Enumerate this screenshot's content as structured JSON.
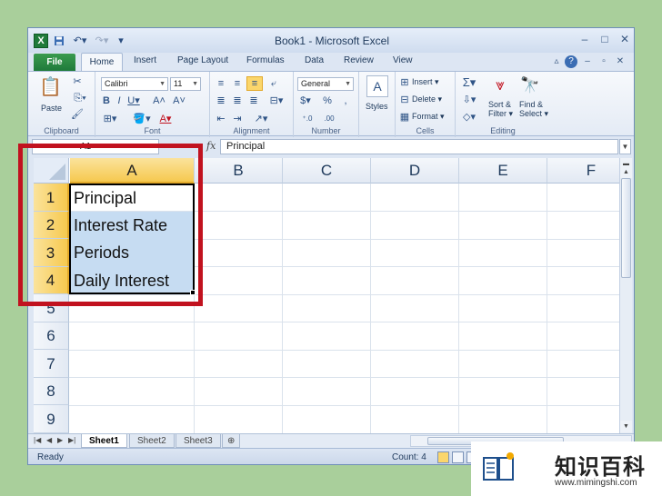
{
  "window": {
    "title": "Book1 - Microsoft Excel"
  },
  "ribbon": {
    "tabs": [
      "File",
      "Home",
      "Insert",
      "Page Layout",
      "Formulas",
      "Data",
      "Review",
      "View"
    ],
    "clipboard": {
      "paste": "Paste",
      "label": "Clipboard"
    },
    "font": {
      "name": "Calibri",
      "size": "11",
      "label": "Font"
    },
    "alignment": {
      "label": "Alignment"
    },
    "number": {
      "format": "General",
      "percent": "%",
      "comma": ",",
      "dollar": "$",
      "label": "Number"
    },
    "styles": {
      "label": "Styles"
    },
    "cells": {
      "insert": "Insert",
      "delete": "Delete",
      "format": "Format",
      "label": "Cells"
    },
    "editing": {
      "sort": "Sort &",
      "filter": "Filter",
      "find": "Find &",
      "select": "Select",
      "sigma": "Σ",
      "label": "Editing"
    }
  },
  "formula_bar": {
    "name_box": "A1",
    "fx": "fx",
    "value": "Principal"
  },
  "grid": {
    "columns": [
      "A",
      "B",
      "C",
      "D",
      "E",
      "F"
    ],
    "selected_column": "A",
    "rows": [
      "1",
      "2",
      "3",
      "4",
      "5",
      "6",
      "7",
      "8",
      "9"
    ],
    "cells": [
      "Principal",
      "Interest Rate",
      "Periods",
      "Daily Interest"
    ]
  },
  "sheets": [
    "Sheet1",
    "Sheet2",
    "Sheet3"
  ],
  "active_sheet": "Sheet1",
  "status": {
    "ready": "Ready",
    "count": "Count: 4"
  },
  "watermark": {
    "text": "知识百科",
    "url": "www.mimingshi.com"
  },
  "colors": {
    "selection_header": "#f6c94f",
    "selection_fill": "#c6dcf2",
    "highlight": "#c1121f",
    "excel_green": "#1f7a3a"
  }
}
